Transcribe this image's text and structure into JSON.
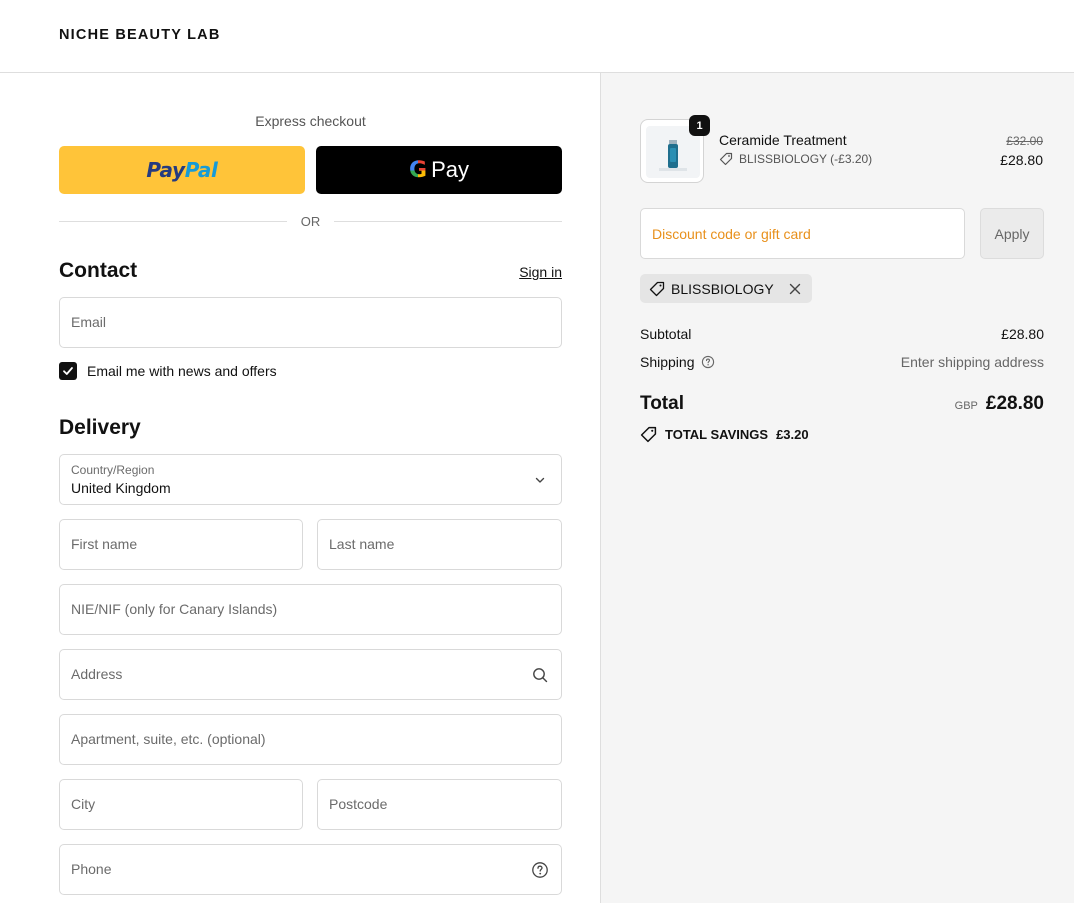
{
  "header": {
    "brand": "NICHE BEAUTY LAB"
  },
  "express": {
    "label": "Express checkout",
    "paypal_part1": "Pay",
    "paypal_part2": "Pal",
    "gpay_g": "G",
    "gpay_text": "Pay",
    "or_text": "OR"
  },
  "contact": {
    "title": "Contact",
    "signin_label": "Sign in",
    "email_placeholder": "Email",
    "newsletter_label": "Email me with news and offers",
    "newsletter_checked": true
  },
  "delivery": {
    "title": "Delivery",
    "country_label": "Country/Region",
    "country_value": "United Kingdom",
    "first_name_placeholder": "First name",
    "last_name_placeholder": "Last name",
    "nie_placeholder": "NIE/NIF (only for Canary Islands)",
    "address_placeholder": "Address",
    "apartment_placeholder": "Apartment, suite, etc. (optional)",
    "city_placeholder": "City",
    "postcode_placeholder": "Postcode",
    "phone_placeholder": "Phone"
  },
  "summary": {
    "item": {
      "quantity": "1",
      "name": "Ceramide Treatment",
      "discount_label": "BLISSBIOLOGY (-£3.20)",
      "original_price": "£32.00",
      "price": "£28.80"
    },
    "discount_placeholder": "Discount code or gift card",
    "apply_label": "Apply",
    "applied_code": "BLISSBIOLOGY",
    "subtotal_label": "Subtotal",
    "subtotal_value": "£28.80",
    "shipping_label": "Shipping",
    "shipping_value": "Enter shipping address",
    "total_label": "Total",
    "total_currency": "GBP",
    "total_value": "£28.80",
    "savings_label": "TOTAL SAVINGS",
    "savings_value": "£3.20"
  },
  "colors": {
    "paypal_bg": "#ffc439",
    "gpay_bg": "#000000",
    "discount_placeholder": "#e8901b",
    "summary_bg": "#f5f5f5"
  }
}
